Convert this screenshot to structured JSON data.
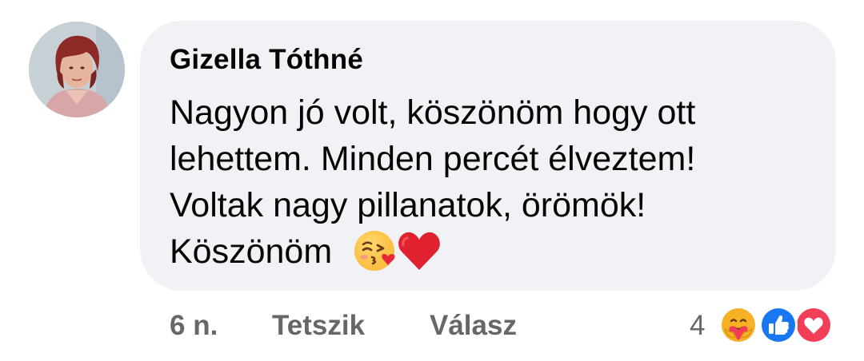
{
  "comment": {
    "author": "Gizella Tóthné",
    "text_lines": [
      "Nagyon jó volt, köszönöm hogy ott",
      "lehettem. Minden percét élveztem!",
      "Voltak nagy pillanatok, örömök!",
      "Köszönöm"
    ],
    "trailing_emojis": [
      "face-blowing-kiss-icon",
      "red-heart-icon"
    ]
  },
  "actions": {
    "time": "6 n.",
    "like_label": "Tetszik",
    "reply_label": "Válasz"
  },
  "reactions": {
    "count": "4",
    "types": [
      "care-icon",
      "like-icon",
      "love-icon"
    ]
  },
  "colors": {
    "bubble": "#f0f2f5",
    "text": "#050505",
    "meta": "#65676b",
    "like_blue": "#1877f2",
    "love_red": "#f33e58"
  }
}
